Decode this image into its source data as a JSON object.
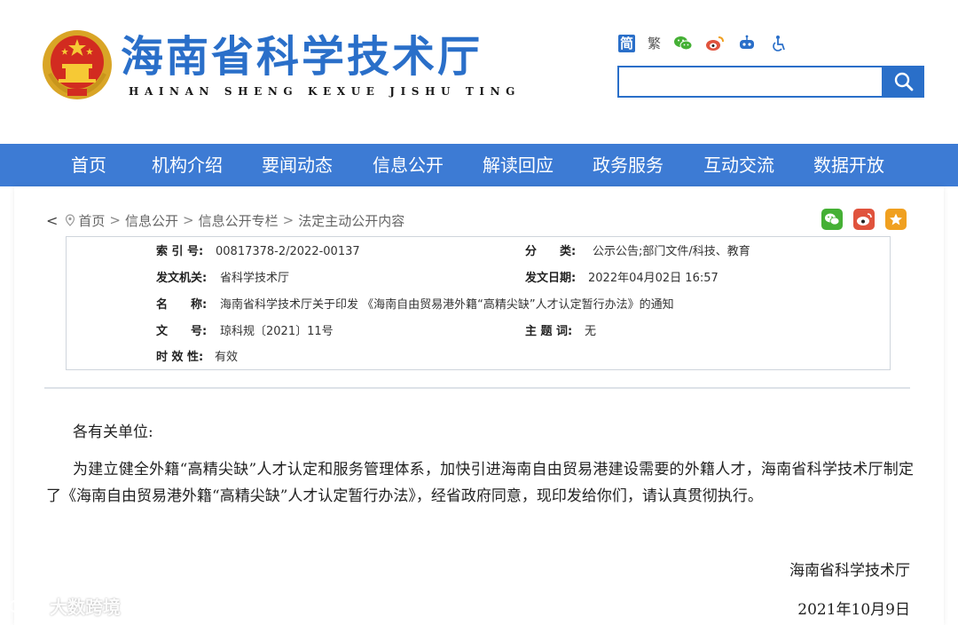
{
  "header": {
    "title": "海南省科学技术厅",
    "subtitle": "HAINAN SHENG KEXUE JISHU TING",
    "toolbar": {
      "simplified": "简",
      "traditional": "繁"
    },
    "search": {
      "placeholder": ""
    }
  },
  "nav": {
    "items": [
      "首页",
      "机构介绍",
      "要闻动态",
      "信息公开",
      "解读回应",
      "政务服务",
      "互动交流",
      "数据开放"
    ]
  },
  "breadcrumb": {
    "items": [
      "首页",
      "信息公开",
      "信息公开专栏",
      "法定主动公开内容"
    ]
  },
  "meta": {
    "index_label": "索 引 号:",
    "index_value": "00817378-2/2022-00137",
    "category_label": "分　　类:",
    "category_value": "公示公告;部门文件/科技、教育",
    "issuer_label": "发文机关:",
    "issuer_value": "省科学技术厅",
    "date_label": "发文日期:",
    "date_value": "2022年04月02日 16:57",
    "name_label": "名　　称:",
    "name_value": "海南省科学技术厅关于印发 《海南自由贸易港外籍“高精尖缺”人才认定暂行办法》的通知",
    "docno_label": "文　　号:",
    "docno_value": "琼科规〔2021〕11号",
    "subject_label": "主 题 词:",
    "subject_value": "无",
    "validity_label": "时 效 性:",
    "validity_value": "有效"
  },
  "document": {
    "greeting": "各有关单位:",
    "body": "为建立健全外籍“高精尖缺”人才认定和服务管理体系，加快引进海南自由贸易港建设需要的外籍人才，海南省科学技术厅制定了《海南自由贸易港外籍“高精尖缺”人才认定暂行办法》，经省政府同意，现印发给你们，请认真贯彻执行。",
    "signature_org": "海南省科学技术厅",
    "signature_date": "2021年10月9日"
  },
  "watermark": {
    "text": "大数跨境"
  },
  "colors": {
    "brand_blue": "#2a6fc9",
    "nav_blue": "#3d7bd4",
    "wechat_green": "#45b035",
    "weibo_red": "#e0533d",
    "favorite_orange": "#f0a020"
  },
  "icons": {
    "toolbar": [
      "wechat-icon",
      "weibo-icon",
      "robot-icon",
      "accessibility-icon"
    ],
    "search": "search-icon",
    "share": [
      "wechat-share-icon",
      "weibo-share-icon",
      "favorite-icon"
    ]
  }
}
